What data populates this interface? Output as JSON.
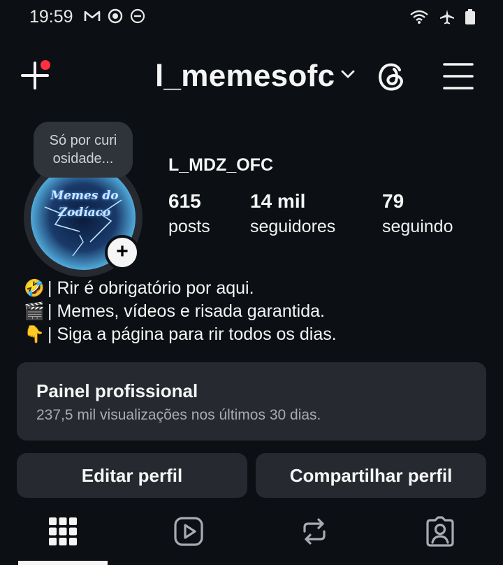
{
  "status_bar": {
    "time": "19:59",
    "left_icons": [
      "gmail-icon",
      "instagram-notif-icon",
      "do-not-disturb-icon"
    ],
    "right_icons": [
      "wifi-icon",
      "airplane-mode-icon",
      "battery-icon"
    ]
  },
  "header": {
    "username": "l_memesofc",
    "new_post_icon": "plus-icon",
    "threads_icon": "threads-icon",
    "menu_icon": "hamburger-menu-icon"
  },
  "profile": {
    "note": "Só por curi osidade...",
    "display_name": "L_MDZ_OFC",
    "avatar_text": "Memes do Zodíaco",
    "stats": [
      {
        "value": "615",
        "label": "posts"
      },
      {
        "value": "14 mil",
        "label": "seguidores"
      },
      {
        "value": "79",
        "label": "seguindo"
      }
    ]
  },
  "bio": [
    {
      "emoji": "🤣",
      "text": "| Rir é obrigatório por aqui."
    },
    {
      "emoji": "🎬",
      "text": "| Memes, vídeos e risada garantida."
    },
    {
      "emoji": "👇",
      "text": "| Siga a página para rir todos os dias."
    }
  ],
  "panel": {
    "title": "Painel profissional",
    "subtitle": "237,5 mil visualizações nos últimos 30 dias."
  },
  "buttons": {
    "edit": "Editar perfil",
    "share": "Compartilhar perfil"
  },
  "tabs": [
    "grid-icon",
    "reels-icon",
    "reposts-icon",
    "tagged-icon"
  ],
  "colors": {
    "background": "#0c1014",
    "surface": "#262a30",
    "notification": "#ff3040",
    "text": "#f5f5f5",
    "muted": "#a8acb2"
  }
}
